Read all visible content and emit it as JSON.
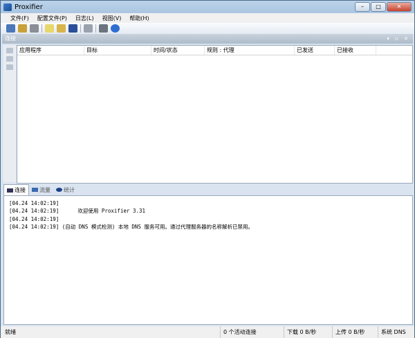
{
  "window": {
    "title": "Proxifier"
  },
  "menu": [
    "文件(F)",
    "配置文件(P)",
    "日志(L)",
    "视图(V)",
    "帮助(H)"
  ],
  "panel": {
    "title": "连接",
    "controls": "▾ ▫ ✕"
  },
  "columns": [
    "应用程序",
    "目标",
    "时间/状态",
    "规则 : 代理",
    "已发送",
    "已接收"
  ],
  "tabs": [
    "连接",
    "流量",
    "统计"
  ],
  "log": [
    "[04.24 14:02:19]",
    "[04.24 14:02:19]      欢迎使用 Proxifier 3.31",
    "[04.24 14:02:19]",
    "[04.24 14:02:19] (自动 DNS 模式检测) 本地 DNS 服务可用。通过代理服务器的名称解析已禁用。"
  ],
  "status": {
    "state": "就绪",
    "connections": "0 个活动连接",
    "download": "下载 0 B/秒",
    "upload": "上传 0 B/秒",
    "dns": "系统 DNS"
  }
}
